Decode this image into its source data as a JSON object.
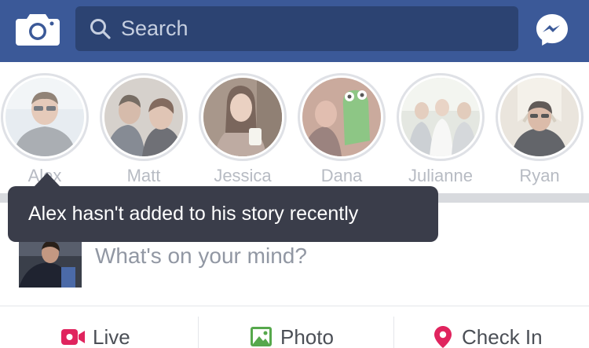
{
  "header": {
    "search_placeholder": "Search",
    "camera_icon": "camera-icon",
    "messenger_icon": "messenger-icon",
    "bar_color": "#3b5998"
  },
  "stories": [
    {
      "name": "Alex"
    },
    {
      "name": "Matt"
    },
    {
      "name": "Jessica"
    },
    {
      "name": "Dana"
    },
    {
      "name": "Julianne"
    },
    {
      "name": "Ryan"
    }
  ],
  "tooltip": {
    "text": "Alex hasn't added to his story recently"
  },
  "composer": {
    "prompt": "What's on your mind?"
  },
  "actions": [
    {
      "label": "Live",
      "icon": "live-video-icon",
      "color": "#e0245e"
    },
    {
      "label": "Photo",
      "icon": "photo-icon",
      "color": "#56a84c"
    },
    {
      "label": "Check In",
      "icon": "location-pin-icon",
      "color": "#e0245e"
    }
  ]
}
